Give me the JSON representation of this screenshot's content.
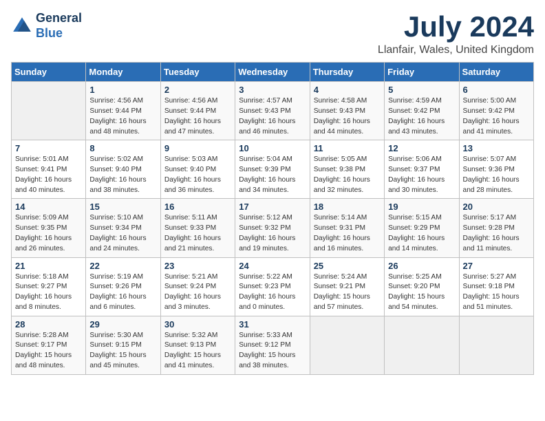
{
  "logo": {
    "line1": "General",
    "line2": "Blue"
  },
  "title": "July 2024",
  "location": "Llanfair, Wales, United Kingdom",
  "weekdays": [
    "Sunday",
    "Monday",
    "Tuesday",
    "Wednesday",
    "Thursday",
    "Friday",
    "Saturday"
  ],
  "weeks": [
    [
      {
        "day": "",
        "sunrise": "",
        "sunset": "",
        "daylight": ""
      },
      {
        "day": "1",
        "sunrise": "Sunrise: 4:56 AM",
        "sunset": "Sunset: 9:44 PM",
        "daylight": "Daylight: 16 hours and 48 minutes."
      },
      {
        "day": "2",
        "sunrise": "Sunrise: 4:56 AM",
        "sunset": "Sunset: 9:44 PM",
        "daylight": "Daylight: 16 hours and 47 minutes."
      },
      {
        "day": "3",
        "sunrise": "Sunrise: 4:57 AM",
        "sunset": "Sunset: 9:43 PM",
        "daylight": "Daylight: 16 hours and 46 minutes."
      },
      {
        "day": "4",
        "sunrise": "Sunrise: 4:58 AM",
        "sunset": "Sunset: 9:43 PM",
        "daylight": "Daylight: 16 hours and 44 minutes."
      },
      {
        "day": "5",
        "sunrise": "Sunrise: 4:59 AM",
        "sunset": "Sunset: 9:42 PM",
        "daylight": "Daylight: 16 hours and 43 minutes."
      },
      {
        "day": "6",
        "sunrise": "Sunrise: 5:00 AM",
        "sunset": "Sunset: 9:42 PM",
        "daylight": "Daylight: 16 hours and 41 minutes."
      }
    ],
    [
      {
        "day": "7",
        "sunrise": "Sunrise: 5:01 AM",
        "sunset": "Sunset: 9:41 PM",
        "daylight": "Daylight: 16 hours and 40 minutes."
      },
      {
        "day": "8",
        "sunrise": "Sunrise: 5:02 AM",
        "sunset": "Sunset: 9:40 PM",
        "daylight": "Daylight: 16 hours and 38 minutes."
      },
      {
        "day": "9",
        "sunrise": "Sunrise: 5:03 AM",
        "sunset": "Sunset: 9:40 PM",
        "daylight": "Daylight: 16 hours and 36 minutes."
      },
      {
        "day": "10",
        "sunrise": "Sunrise: 5:04 AM",
        "sunset": "Sunset: 9:39 PM",
        "daylight": "Daylight: 16 hours and 34 minutes."
      },
      {
        "day": "11",
        "sunrise": "Sunrise: 5:05 AM",
        "sunset": "Sunset: 9:38 PM",
        "daylight": "Daylight: 16 hours and 32 minutes."
      },
      {
        "day": "12",
        "sunrise": "Sunrise: 5:06 AM",
        "sunset": "Sunset: 9:37 PM",
        "daylight": "Daylight: 16 hours and 30 minutes."
      },
      {
        "day": "13",
        "sunrise": "Sunrise: 5:07 AM",
        "sunset": "Sunset: 9:36 PM",
        "daylight": "Daylight: 16 hours and 28 minutes."
      }
    ],
    [
      {
        "day": "14",
        "sunrise": "Sunrise: 5:09 AM",
        "sunset": "Sunset: 9:35 PM",
        "daylight": "Daylight: 16 hours and 26 minutes."
      },
      {
        "day": "15",
        "sunrise": "Sunrise: 5:10 AM",
        "sunset": "Sunset: 9:34 PM",
        "daylight": "Daylight: 16 hours and 24 minutes."
      },
      {
        "day": "16",
        "sunrise": "Sunrise: 5:11 AM",
        "sunset": "Sunset: 9:33 PM",
        "daylight": "Daylight: 16 hours and 21 minutes."
      },
      {
        "day": "17",
        "sunrise": "Sunrise: 5:12 AM",
        "sunset": "Sunset: 9:32 PM",
        "daylight": "Daylight: 16 hours and 19 minutes."
      },
      {
        "day": "18",
        "sunrise": "Sunrise: 5:14 AM",
        "sunset": "Sunset: 9:31 PM",
        "daylight": "Daylight: 16 hours and 16 minutes."
      },
      {
        "day": "19",
        "sunrise": "Sunrise: 5:15 AM",
        "sunset": "Sunset: 9:29 PM",
        "daylight": "Daylight: 16 hours and 14 minutes."
      },
      {
        "day": "20",
        "sunrise": "Sunrise: 5:17 AM",
        "sunset": "Sunset: 9:28 PM",
        "daylight": "Daylight: 16 hours and 11 minutes."
      }
    ],
    [
      {
        "day": "21",
        "sunrise": "Sunrise: 5:18 AM",
        "sunset": "Sunset: 9:27 PM",
        "daylight": "Daylight: 16 hours and 8 minutes."
      },
      {
        "day": "22",
        "sunrise": "Sunrise: 5:19 AM",
        "sunset": "Sunset: 9:26 PM",
        "daylight": "Daylight: 16 hours and 6 minutes."
      },
      {
        "day": "23",
        "sunrise": "Sunrise: 5:21 AM",
        "sunset": "Sunset: 9:24 PM",
        "daylight": "Daylight: 16 hours and 3 minutes."
      },
      {
        "day": "24",
        "sunrise": "Sunrise: 5:22 AM",
        "sunset": "Sunset: 9:23 PM",
        "daylight": "Daylight: 16 hours and 0 minutes."
      },
      {
        "day": "25",
        "sunrise": "Sunrise: 5:24 AM",
        "sunset": "Sunset: 9:21 PM",
        "daylight": "Daylight: 15 hours and 57 minutes."
      },
      {
        "day": "26",
        "sunrise": "Sunrise: 5:25 AM",
        "sunset": "Sunset: 9:20 PM",
        "daylight": "Daylight: 15 hours and 54 minutes."
      },
      {
        "day": "27",
        "sunrise": "Sunrise: 5:27 AM",
        "sunset": "Sunset: 9:18 PM",
        "daylight": "Daylight: 15 hours and 51 minutes."
      }
    ],
    [
      {
        "day": "28",
        "sunrise": "Sunrise: 5:28 AM",
        "sunset": "Sunset: 9:17 PM",
        "daylight": "Daylight: 15 hours and 48 minutes."
      },
      {
        "day": "29",
        "sunrise": "Sunrise: 5:30 AM",
        "sunset": "Sunset: 9:15 PM",
        "daylight": "Daylight: 15 hours and 45 minutes."
      },
      {
        "day": "30",
        "sunrise": "Sunrise: 5:32 AM",
        "sunset": "Sunset: 9:13 PM",
        "daylight": "Daylight: 15 hours and 41 minutes."
      },
      {
        "day": "31",
        "sunrise": "Sunrise: 5:33 AM",
        "sunset": "Sunset: 9:12 PM",
        "daylight": "Daylight: 15 hours and 38 minutes."
      },
      {
        "day": "",
        "sunrise": "",
        "sunset": "",
        "daylight": ""
      },
      {
        "day": "",
        "sunrise": "",
        "sunset": "",
        "daylight": ""
      },
      {
        "day": "",
        "sunrise": "",
        "sunset": "",
        "daylight": ""
      }
    ]
  ]
}
